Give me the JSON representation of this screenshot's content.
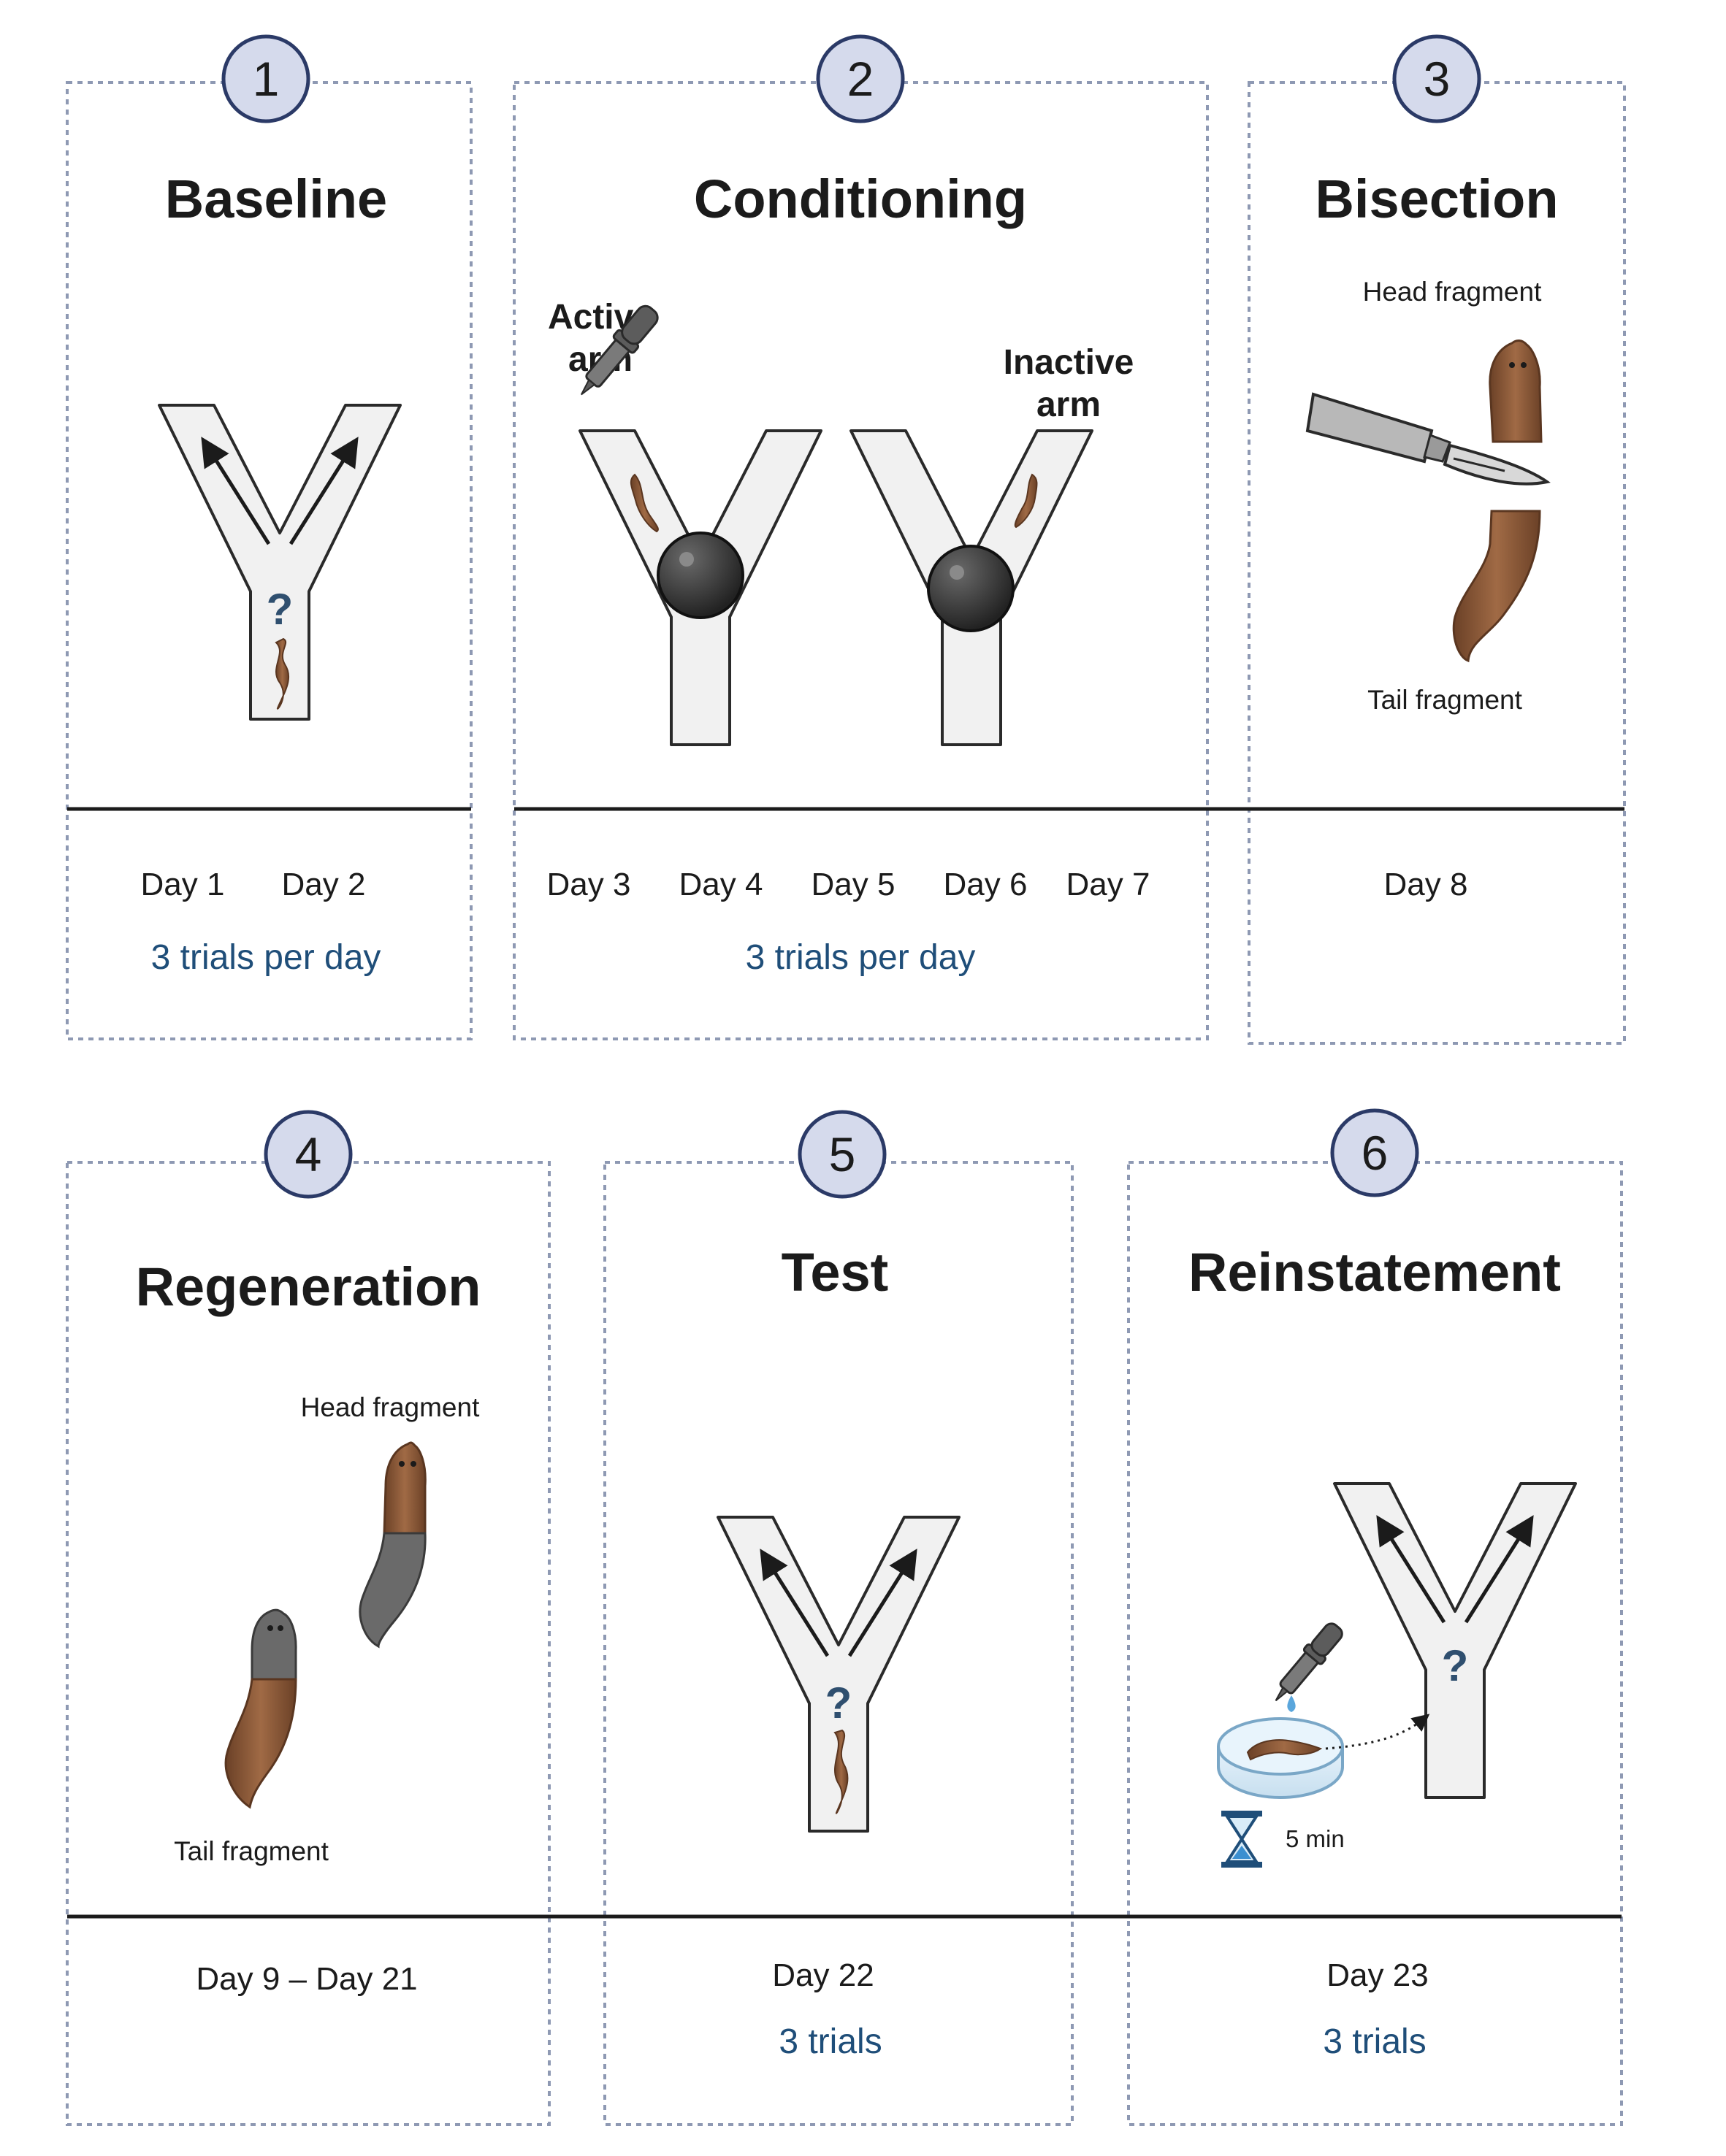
{
  "panels": [
    {
      "number": "1",
      "title": "Baseline",
      "days": [
        "Day 1",
        "Day 2"
      ],
      "trials": "3 trials per day"
    },
    {
      "number": "2",
      "title": "Conditioning",
      "days": [
        "Day 3",
        "Day 4",
        "Day 5",
        "Day 6",
        "Day 7"
      ],
      "trials": "3 trials per day",
      "active_arm": [
        "Active",
        "arm"
      ],
      "inactive_arm": [
        "Inactive",
        "arm"
      ]
    },
    {
      "number": "3",
      "title": "Bisection",
      "days": [
        "Day 8"
      ],
      "head_label": "Head fragment",
      "tail_label": "Tail fragment"
    },
    {
      "number": "4",
      "title": "Regeneration",
      "days": [
        "Day 9 – Day 21"
      ],
      "head_label": "Head fragment",
      "tail_label": "Tail fragment"
    },
    {
      "number": "5",
      "title": "Test",
      "days": [
        "Day 22"
      ],
      "trials": "3 trials"
    },
    {
      "number": "6",
      "title": "Reinstatement",
      "days": [
        "Day 23"
      ],
      "trials": "3 trials",
      "timer": "5 min"
    }
  ],
  "question_mark": "?",
  "colors": {
    "border": "#8e99b3",
    "badge_fill": "#d5daec",
    "badge_stroke": "#2b3a67",
    "trials": "#1f4e79",
    "worm": "#8a5a3a",
    "worm_grey": "#6a6a6a",
    "maze_fill": "#f1f1f1",
    "ball": "#3a3a3a"
  },
  "icons": [
    "y-maze-icon",
    "planarian-icon",
    "dropper-icon",
    "scalpel-icon",
    "petri-dish-icon",
    "hourglass-icon",
    "ball-icon"
  ]
}
